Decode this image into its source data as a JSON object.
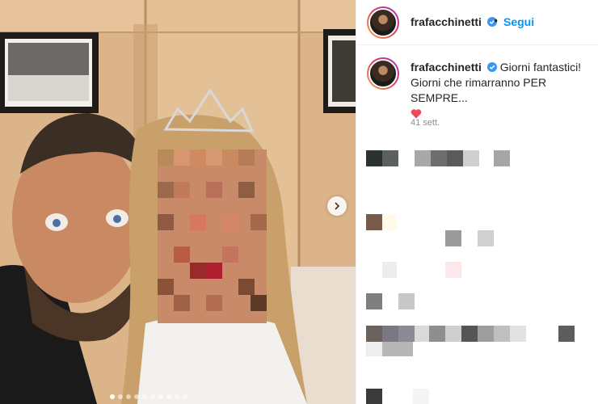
{
  "post": {
    "username": "frafacchinetti",
    "follow_label": "Segui",
    "separator": "•",
    "caption_line1": "Giorni fantastici!",
    "caption_line2": "Giorni che rimarranno PER SEMPRE...",
    "time_ago": "41 sett.",
    "carousel": {
      "slides": 10,
      "active_index": 0
    }
  },
  "icons": {
    "verified": "verified-badge-icon",
    "next": "chevron-right-icon",
    "heart": "red-heart-icon"
  },
  "colors": {
    "accent": "#0095f6",
    "heart": "#ed4956",
    "muted": "#8e8e8e"
  }
}
